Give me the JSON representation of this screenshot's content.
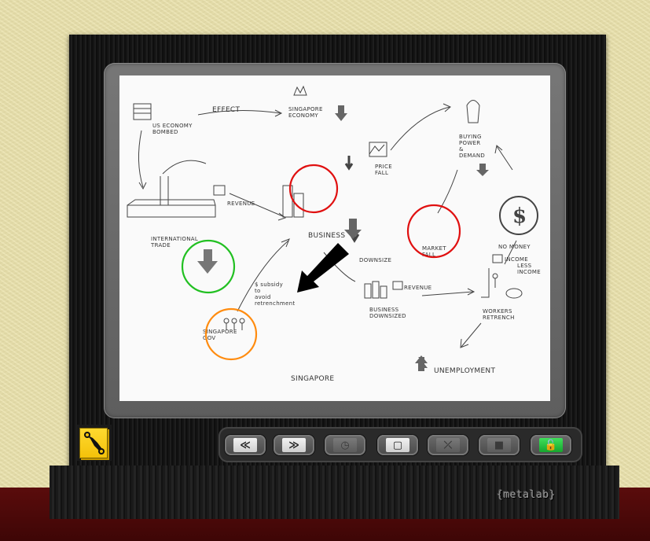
{
  "diagram": {
    "labels": {
      "us_economy": "US ECONOMY\nBOMBED",
      "effect": "EFFECT",
      "singapore_economy": "SINGAPORE\nECONOMY",
      "price_fall": "PRICE\nFALL",
      "buying_power": "BUYING\nPOWER\n&\nDEMAND",
      "revenue": "REVENUE",
      "international_trade": "INTERNATIONAL\nTRADE",
      "business": "BUSINESS",
      "market_fall": "MARKET\nFALL",
      "no_money": "NO MONEY",
      "downsize": "DOWNSIZE",
      "subsidy": "$ subsidy\nto\navoid\nretrenchment",
      "business_downsized": "BUSINESS\nDOWNSIZED",
      "revenue_small": "REVENUE",
      "income": "INCOME",
      "less_income": "LESS\nINCOME",
      "workers_retrench": "WORKERS\nRETRENCH",
      "singapore_gov": "SINGAPORE\nGOV",
      "unemployment": "UNEMPLOYMENT",
      "singapore": "SINGAPORE"
    },
    "highlight_colors": {
      "red": "#e01010",
      "green": "#22c022",
      "orange": "#ff8c10",
      "pointer": "#000000"
    }
  },
  "toolbar": {
    "tools_icon": "wrench-icon",
    "buttons": [
      {
        "name": "rewind",
        "glyph": "≪",
        "icon": "rewind-icon"
      },
      {
        "name": "fast-forward",
        "glyph": "≫",
        "icon": "fast-forward-icon"
      },
      {
        "name": "timer",
        "glyph": "◷",
        "icon": "clock-icon"
      },
      {
        "name": "page",
        "glyph": "▢",
        "icon": "page-icon"
      },
      {
        "name": "fit",
        "glyph": "⤫",
        "icon": "fit-screen-icon"
      },
      {
        "name": "lock",
        "glyph": "■",
        "icon": "lock-icon"
      },
      {
        "name": "unlock",
        "glyph": "🔓",
        "icon": "unlock-icon"
      }
    ]
  },
  "brand": "{metalab}"
}
